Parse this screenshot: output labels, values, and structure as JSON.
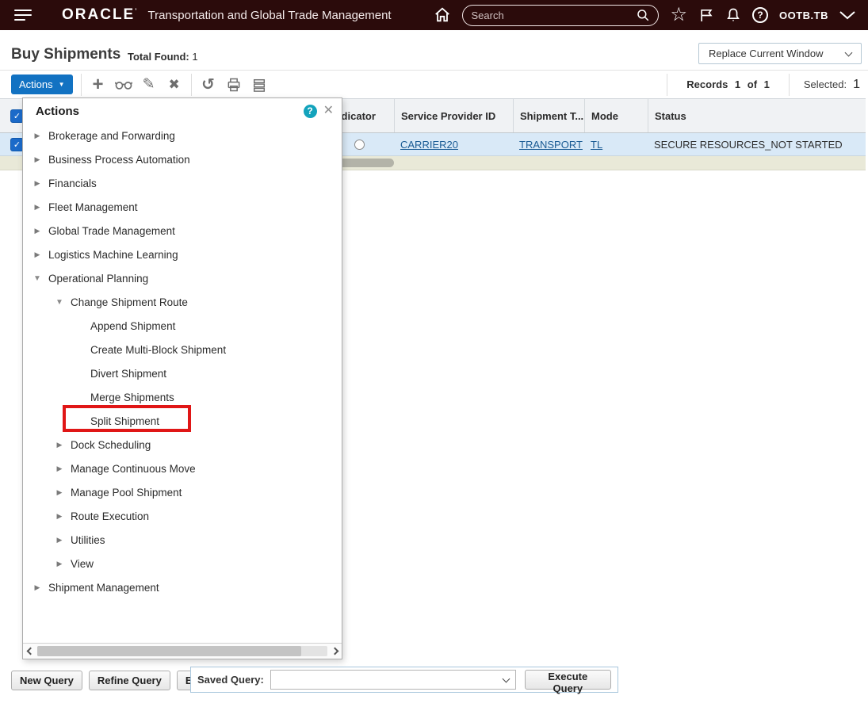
{
  "topbar": {
    "brand": "ORACLE",
    "title": "Transportation and Global Trade Management",
    "search_placeholder": "Search",
    "user": "OOTB.TB"
  },
  "page": {
    "title": "Buy Shipments",
    "total_found_label": "Total Found:",
    "total_found_value": "1",
    "window_mode_value": "Replace Current Window"
  },
  "toolbar": {
    "actions_label": "Actions",
    "records_label": "Records 1 of 1",
    "selected_label": "Selected:",
    "selected_value": "1"
  },
  "table": {
    "columns": {
      "indicator": "Indicator",
      "service_provider": "Service Provider ID",
      "shipment_type": "Shipment T...",
      "mode": "Mode",
      "status": "Status"
    },
    "row": {
      "service_provider": "CARRIER20",
      "shipment_type": "TRANSPORT",
      "mode": "TL",
      "status": "SECURE RESOURCES_NOT STARTED"
    }
  },
  "popup": {
    "title": "Actions",
    "items": [
      {
        "label": "Brokerage and Forwarding",
        "level": 1,
        "state": "collapsed"
      },
      {
        "label": "Business Process Automation",
        "level": 1,
        "state": "collapsed"
      },
      {
        "label": "Financials",
        "level": 1,
        "state": "collapsed"
      },
      {
        "label": "Fleet Management",
        "level": 1,
        "state": "collapsed"
      },
      {
        "label": "Global Trade Management",
        "level": 1,
        "state": "collapsed"
      },
      {
        "label": "Logistics Machine Learning",
        "level": 1,
        "state": "collapsed"
      },
      {
        "label": "Operational Planning",
        "level": 1,
        "state": "expanded"
      },
      {
        "label": "Change Shipment Route",
        "level": 2,
        "state": "expanded"
      },
      {
        "label": "Append Shipment",
        "level": 3,
        "state": "leaf"
      },
      {
        "label": "Create Multi-Block Shipment",
        "level": 3,
        "state": "leaf"
      },
      {
        "label": "Divert Shipment",
        "level": 3,
        "state": "leaf"
      },
      {
        "label": "Merge Shipments",
        "level": 3,
        "state": "leaf"
      },
      {
        "label": "Split Shipment",
        "level": 3,
        "state": "leaf",
        "highlighted": true
      },
      {
        "label": "Dock Scheduling",
        "level": 2,
        "state": "collapsed"
      },
      {
        "label": "Manage Continuous Move",
        "level": 2,
        "state": "collapsed"
      },
      {
        "label": "Manage Pool Shipment",
        "level": 2,
        "state": "collapsed"
      },
      {
        "label": "Route Execution",
        "level": 2,
        "state": "collapsed"
      },
      {
        "label": "Utilities",
        "level": 2,
        "state": "collapsed"
      },
      {
        "label": "View",
        "level": 2,
        "state": "collapsed"
      },
      {
        "label": "Shipment Management",
        "level": 1,
        "state": "collapsed"
      }
    ]
  },
  "query_bar": {
    "new_query": "New Query",
    "refine_query": "Refine Query",
    "export": "Export",
    "saved_query_label": "Saved Query:",
    "saved_query_value": "",
    "execute_query": "Execute Query"
  },
  "colors": {
    "topbar_background": "#2b0b0b",
    "accent_blue": "#1272c2",
    "link_blue": "#1a5b94",
    "selected_row": "#d9e9f7",
    "summary_row": "#e9e9d8",
    "highlight_red": "#e01616",
    "help_teal": "#13a3bc"
  }
}
